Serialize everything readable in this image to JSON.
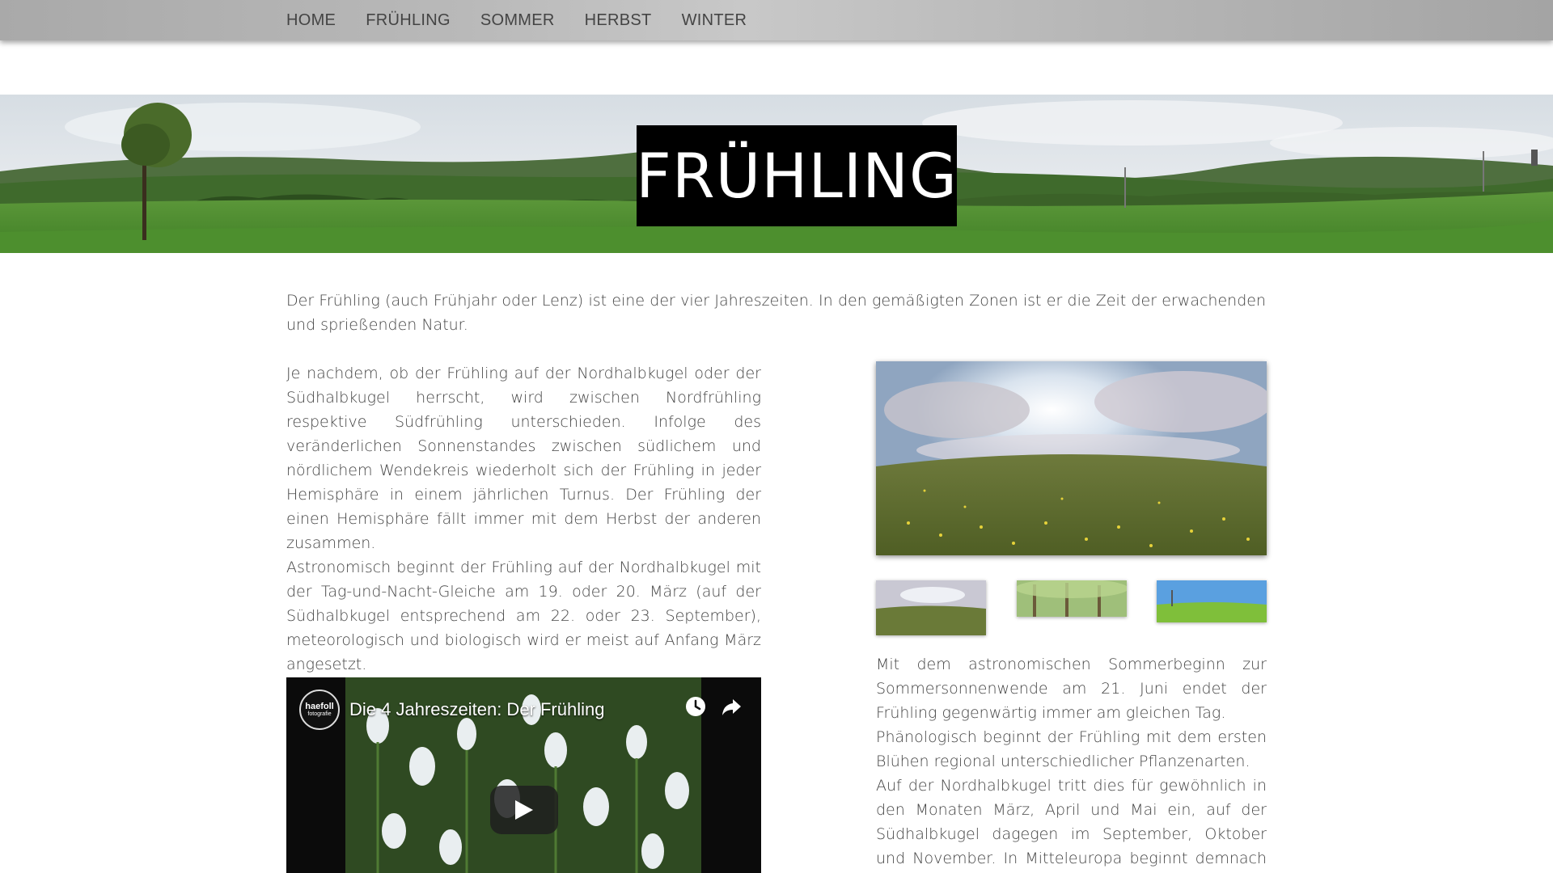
{
  "nav": {
    "items": [
      "HOME",
      "FRÜHLING",
      "SOMMER",
      "HERBST",
      "WINTER"
    ]
  },
  "banner": {
    "title": "FRÜHLING"
  },
  "content": {
    "intro": "Der Frühling (auch Frühjahr oder Lenz) ist eine der vier Jahreszeiten. In den gemäßigten Zonen ist er die Zeit der erwachenden und sprießenden Natur.",
    "left_paragraphs": [
      "Je nachdem, ob der Frühling auf der Nordhalbkugel oder der Südhalbkugel herrscht, wird zwischen Nordfrühling respektive Südfrühling unterschieden. Infolge des veränderlichen Sonnenstandes zwischen südlichem und nördlichem Wendekreis wiederholt sich der Frühling in jeder Hemisphäre in einem jährlichen Turnus. Der Frühling der einen Hemisphäre fällt immer mit dem Herbst der anderen zusammen.",
      "Astronomisch beginnt der Frühling auf der Nordhalbkugel mit der Tag-und-Nacht-Gleiche am 19. oder 20. März (auf der Südhalbkugel entsprechend am 22. oder 23. September), meteorologisch und biologisch wird er meist auf Anfang März angesetzt."
    ],
    "right_paragraphs": [
      "Mit dem astronomischen Sommerbeginn zur Sommersonnenwende am 21. Juni endet der Frühling gegenwärtig immer am gleichen Tag.",
      "Phänologisch beginnt der Frühling mit dem ersten Blühen regional unterschiedlicher Pflanzenarten.",
      "Auf der Nordhalbkugel tritt dies für gewöhnlich in den Monaten März, April und Mai ein, auf der Südhalbkugel dagegen im September, Oktober und November. In Mitteleuropa beginnt demnach der"
    ]
  },
  "video": {
    "title": "Die 4 Jahreszeiten: Der Frühling",
    "channel_line1": "haefoll",
    "channel_line2": "fotografie",
    "icons": [
      "clock-icon",
      "share-icon",
      "play-icon"
    ]
  },
  "colors": {
    "nav_bg": "#b8b8b8",
    "title_bg": "#000000",
    "text": "#444444"
  }
}
